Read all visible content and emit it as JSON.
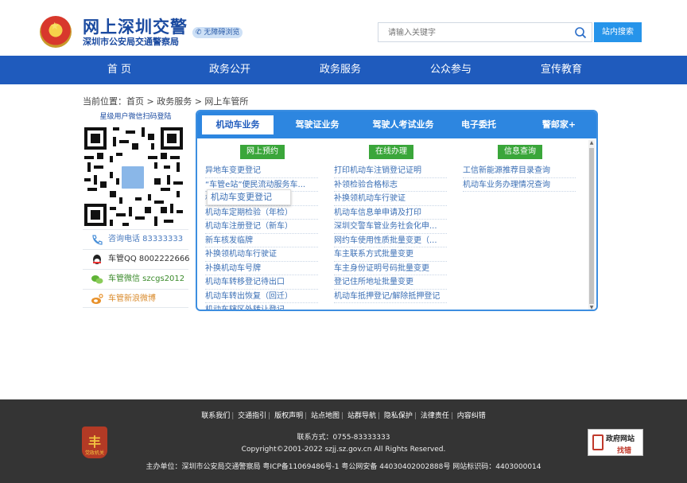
{
  "header": {
    "title": "网上深圳交警",
    "subtitle": "深圳市公安局交通警察局",
    "accessibility": "无障碍浏览",
    "search_placeholder": "请输入关键字",
    "search_button": "站内搜索",
    "icons": [
      "police-emblem-icon",
      "search-icon"
    ]
  },
  "nav": {
    "items": [
      "首 页",
      "政务公开",
      "政务服务",
      "公众参与",
      "宣传教育"
    ],
    "color": "#1f5bbd"
  },
  "breadcrumb": "当前位置：首页 > 政务服务 > 网上车管所",
  "left": {
    "qr_title": "星级用户微信扫码登陆",
    "contacts": [
      {
        "icon": "phone-icon",
        "text": "咨询电话 83333333"
      },
      {
        "icon": "qq-icon",
        "text": "车管QQ 8002222666"
      },
      {
        "icon": "wechat-icon",
        "text": "车管微信 szcgs2012"
      },
      {
        "icon": "weibo-icon",
        "text": "车管新浪微博"
      }
    ]
  },
  "panel": {
    "tabs": [
      "机动车业务",
      "驾驶证业务",
      "驾驶人考试业务",
      "电子委托",
      "警邮家+"
    ],
    "active_tab": "机动车业务",
    "columns": [
      {
        "header": "网上预约",
        "items": [
          "异地车变更登记",
          "“车管e站”便民流动服务车...",
          "机动车变更登记",
          "机动车定期检验（年检）",
          "机动车注册登记（新车）",
          "新车核发临牌",
          "补换领机动车行驶证",
          "补换机动车号牌",
          "机动车转移登记待出口",
          "机动车转出恢复（回迁）",
          "机动车辖区外转让登记"
        ]
      },
      {
        "header": "在线办理",
        "items": [
          "打印机动车注销登记证明",
          "补领检验合格标志",
          "补换领机动车行驶证",
          "机动车信息单申请及打印",
          "深圳交警车管业务社会化申...",
          "网约车使用性质批量变更（...",
          "车主联系方式批量变更",
          "车主身份证明号码批量变更",
          "登记住所地址批量变更",
          "机动车抵押登记/解除抵押登记"
        ]
      },
      {
        "header": "信息查询",
        "items": [
          "工信新能源推荐目录查询",
          "机动车业务办理情况查询"
        ]
      }
    ],
    "tooltip": "机动车变更登记",
    "accent": "#2d86e0",
    "green": "#3aa63a"
  },
  "footer": {
    "links": [
      "联系我们",
      "交通指引",
      "版权声明",
      "站点地图",
      "站群导航",
      "隐私保护",
      "法律责任",
      "内容纠错"
    ],
    "contact": "联系方式：0755-83333333",
    "copyright": "Copyright©2001-2022 szjj.sz.gov.cn    All Rights Reserved.",
    "host": "主办单位：深圳市公安局交通警察局   粤ICP备11069486号-1   粤公网安备 44030402002888号   网站标识码：4403000014",
    "gov_badge_text": "党政机关",
    "gov_site_line1": "政府网站",
    "gov_site_line2": "找错"
  }
}
